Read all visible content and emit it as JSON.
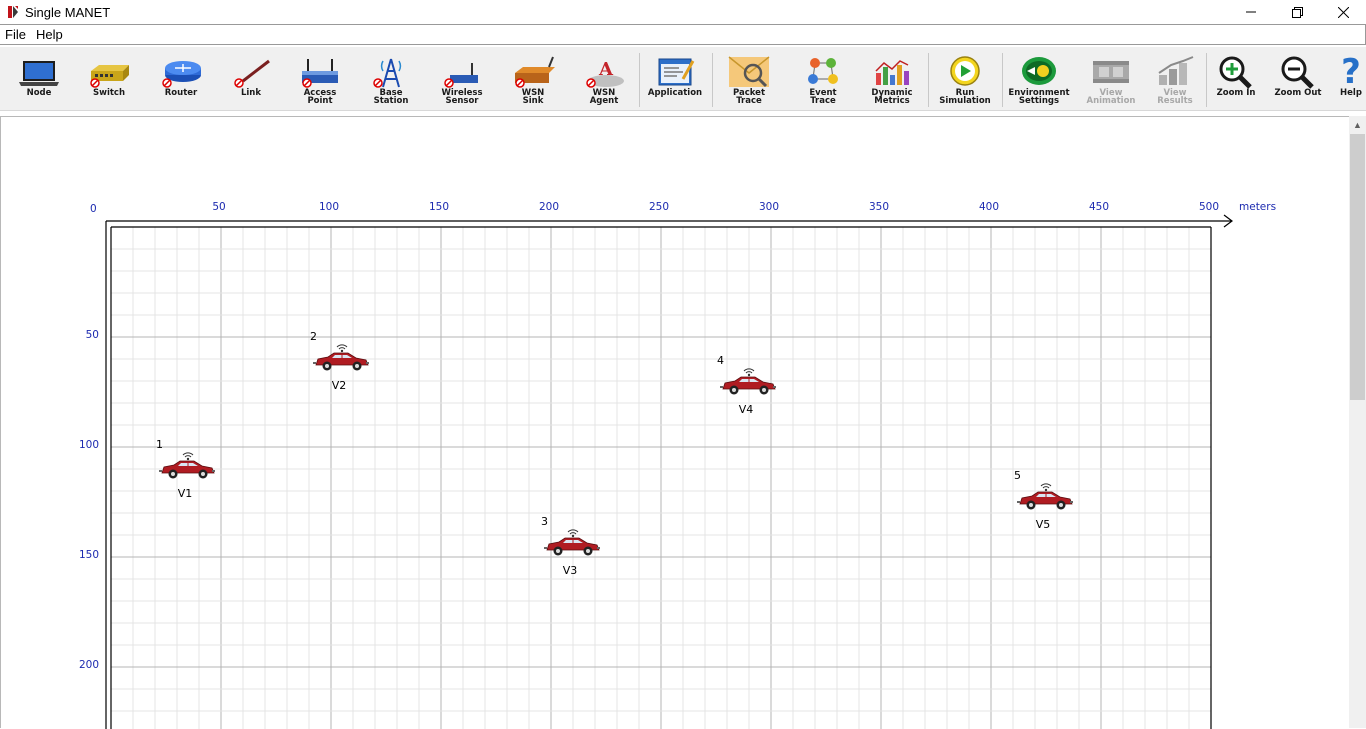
{
  "window": {
    "title": "Single MANET",
    "minimize": "—",
    "restore": "❐",
    "close": "✕"
  },
  "menu": [
    {
      "label": "File"
    },
    {
      "label": "Help"
    }
  ],
  "toolbar": [
    {
      "label": "Node",
      "icon": "laptop-icon"
    },
    {
      "label": "Switch",
      "icon": "switch-icon"
    },
    {
      "label": "Router",
      "icon": "router-icon"
    },
    {
      "label": "Link",
      "icon": "link-icon"
    },
    {
      "label": "Access\nPoint",
      "icon": "access-point-icon"
    },
    {
      "label": "Base\nStation",
      "icon": "base-station-icon"
    },
    {
      "label": "Wireless\nSensor",
      "icon": "wireless-sensor-icon"
    },
    {
      "label": "WSN\nSink",
      "icon": "wsn-sink-icon"
    },
    {
      "label": "WSN\nAgent",
      "icon": "wsn-agent-icon"
    },
    {
      "label": "Application",
      "icon": "application-icon"
    },
    {
      "label": "Packet\nTrace",
      "icon": "packet-trace-icon"
    },
    {
      "label": "Event\nTrace",
      "icon": "event-trace-icon"
    },
    {
      "label": "Dynamic\nMetrics",
      "icon": "dynamic-metrics-icon"
    },
    {
      "label": "Run\nSimulation",
      "icon": "run-simulation-icon"
    },
    {
      "label": "Environment\nSettings",
      "icon": "environment-settings-icon"
    },
    {
      "label": "View\nAnimation",
      "icon": "view-animation-icon",
      "disabled": true
    },
    {
      "label": "View\nResults",
      "icon": "view-results-icon",
      "disabled": true
    },
    {
      "label": "Zoom In",
      "icon": "zoom-in-icon"
    },
    {
      "label": "Zoom Out",
      "icon": "zoom-out-icon"
    },
    {
      "label": "Help",
      "icon": "help-icon"
    }
  ],
  "grid": {
    "x_ticks": [
      "0",
      "50",
      "100",
      "150",
      "200",
      "250",
      "300",
      "350",
      "400",
      "450",
      "500"
    ],
    "x_unit": "meters",
    "y_ticks": [
      "50",
      "100",
      "150",
      "200"
    ]
  },
  "nodes": [
    {
      "id": "1",
      "name": "V1",
      "x_m": 40,
      "y_m": 110
    },
    {
      "id": "2",
      "name": "V2",
      "x_m": 110,
      "y_m": 61
    },
    {
      "id": "3",
      "name": "V3",
      "x_m": 215,
      "y_m": 145
    },
    {
      "id": "4",
      "name": "V4",
      "x_m": 295,
      "y_m": 72
    },
    {
      "id": "5",
      "name": "V5",
      "x_m": 430,
      "y_m": 124
    }
  ],
  "colors": {
    "axis_label": "#1d2bb0",
    "car": "#b01c22",
    "grid_minor": "#e4e4e4",
    "grid_major": "#b4b4b4"
  }
}
